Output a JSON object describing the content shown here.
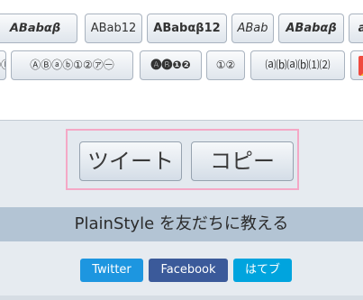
{
  "style_buttons": {
    "row1": [
      "𝘼𝘽𝙖𝙗𝞪𝞫",
      "ABab12",
      "ABabαβ12",
      "ABab",
      "ABabαβ",
      "𝙖"
    ],
    "row2": [
      "Ⓐⓑ",
      "ⒶⒷⓐⓑ①②㋐㊀",
      "🅐🅑❶❷",
      "①②",
      "⒜⒝⒜⒝⑴⑵"
    ]
  },
  "actions": {
    "tweet_label": "ツイート",
    "copy_label": "コピー"
  },
  "share": {
    "heading": "PlainStyle を友だちに教える",
    "twitter_label": "Twitter",
    "facebook_label": "Facebook",
    "hatena_label": "はてブ"
  },
  "colors": {
    "twitter": "#1d96e0",
    "facebook": "#3b5a9a",
    "hatena": "#00a4de",
    "frame_highlight": "#f4a8c6",
    "share_bar": "#b3c4d4"
  }
}
